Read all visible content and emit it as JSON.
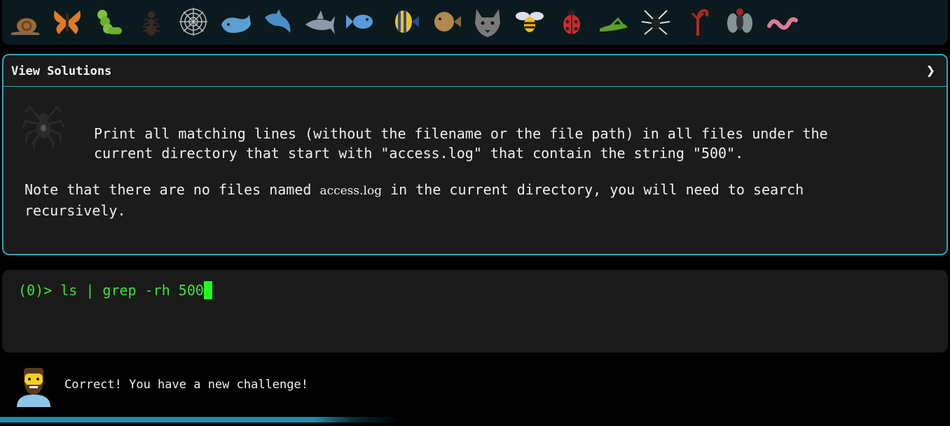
{
  "animals": [
    {
      "name": "snail-icon"
    },
    {
      "name": "butterfly-icon"
    },
    {
      "name": "caterpillar-icon"
    },
    {
      "name": "ant-icon"
    },
    {
      "name": "spider-web-icon"
    },
    {
      "name": "whale-icon"
    },
    {
      "name": "dolphin-icon"
    },
    {
      "name": "shark-icon"
    },
    {
      "name": "fish-icon"
    },
    {
      "name": "tropical-fish-icon"
    },
    {
      "name": "blowfish-icon"
    },
    {
      "name": "wolf-icon"
    },
    {
      "name": "bee-icon"
    },
    {
      "name": "ladybug-icon"
    },
    {
      "name": "cricket-icon"
    },
    {
      "name": "spider-icon"
    },
    {
      "name": "scorpion-icon"
    },
    {
      "name": "fly-icon"
    },
    {
      "name": "worm-icon"
    }
  ],
  "panel": {
    "title": "View Solutions",
    "chevron": "❯",
    "description": "Print all matching lines (without the filename or the file path) in all files under the\ncurrent directory that start with \"access.log\" that contain the string \"500\".",
    "note_before": "Note that there are no files named ",
    "note_code": "access.log",
    "note_after": " in the current directory, you will need to search recursively."
  },
  "terminal": {
    "prompt": "(0)> ",
    "command": "ls | grep -rh 500"
  },
  "feedback": {
    "message": "Correct! You have a new challenge!"
  },
  "progress": {
    "fraction": 0.6
  },
  "colors": {
    "accent": "#2aa6c4",
    "prompt_green": "#3ee23e",
    "cursor_green": "#22ff22",
    "panel_bg": "#1b1b1b"
  }
}
